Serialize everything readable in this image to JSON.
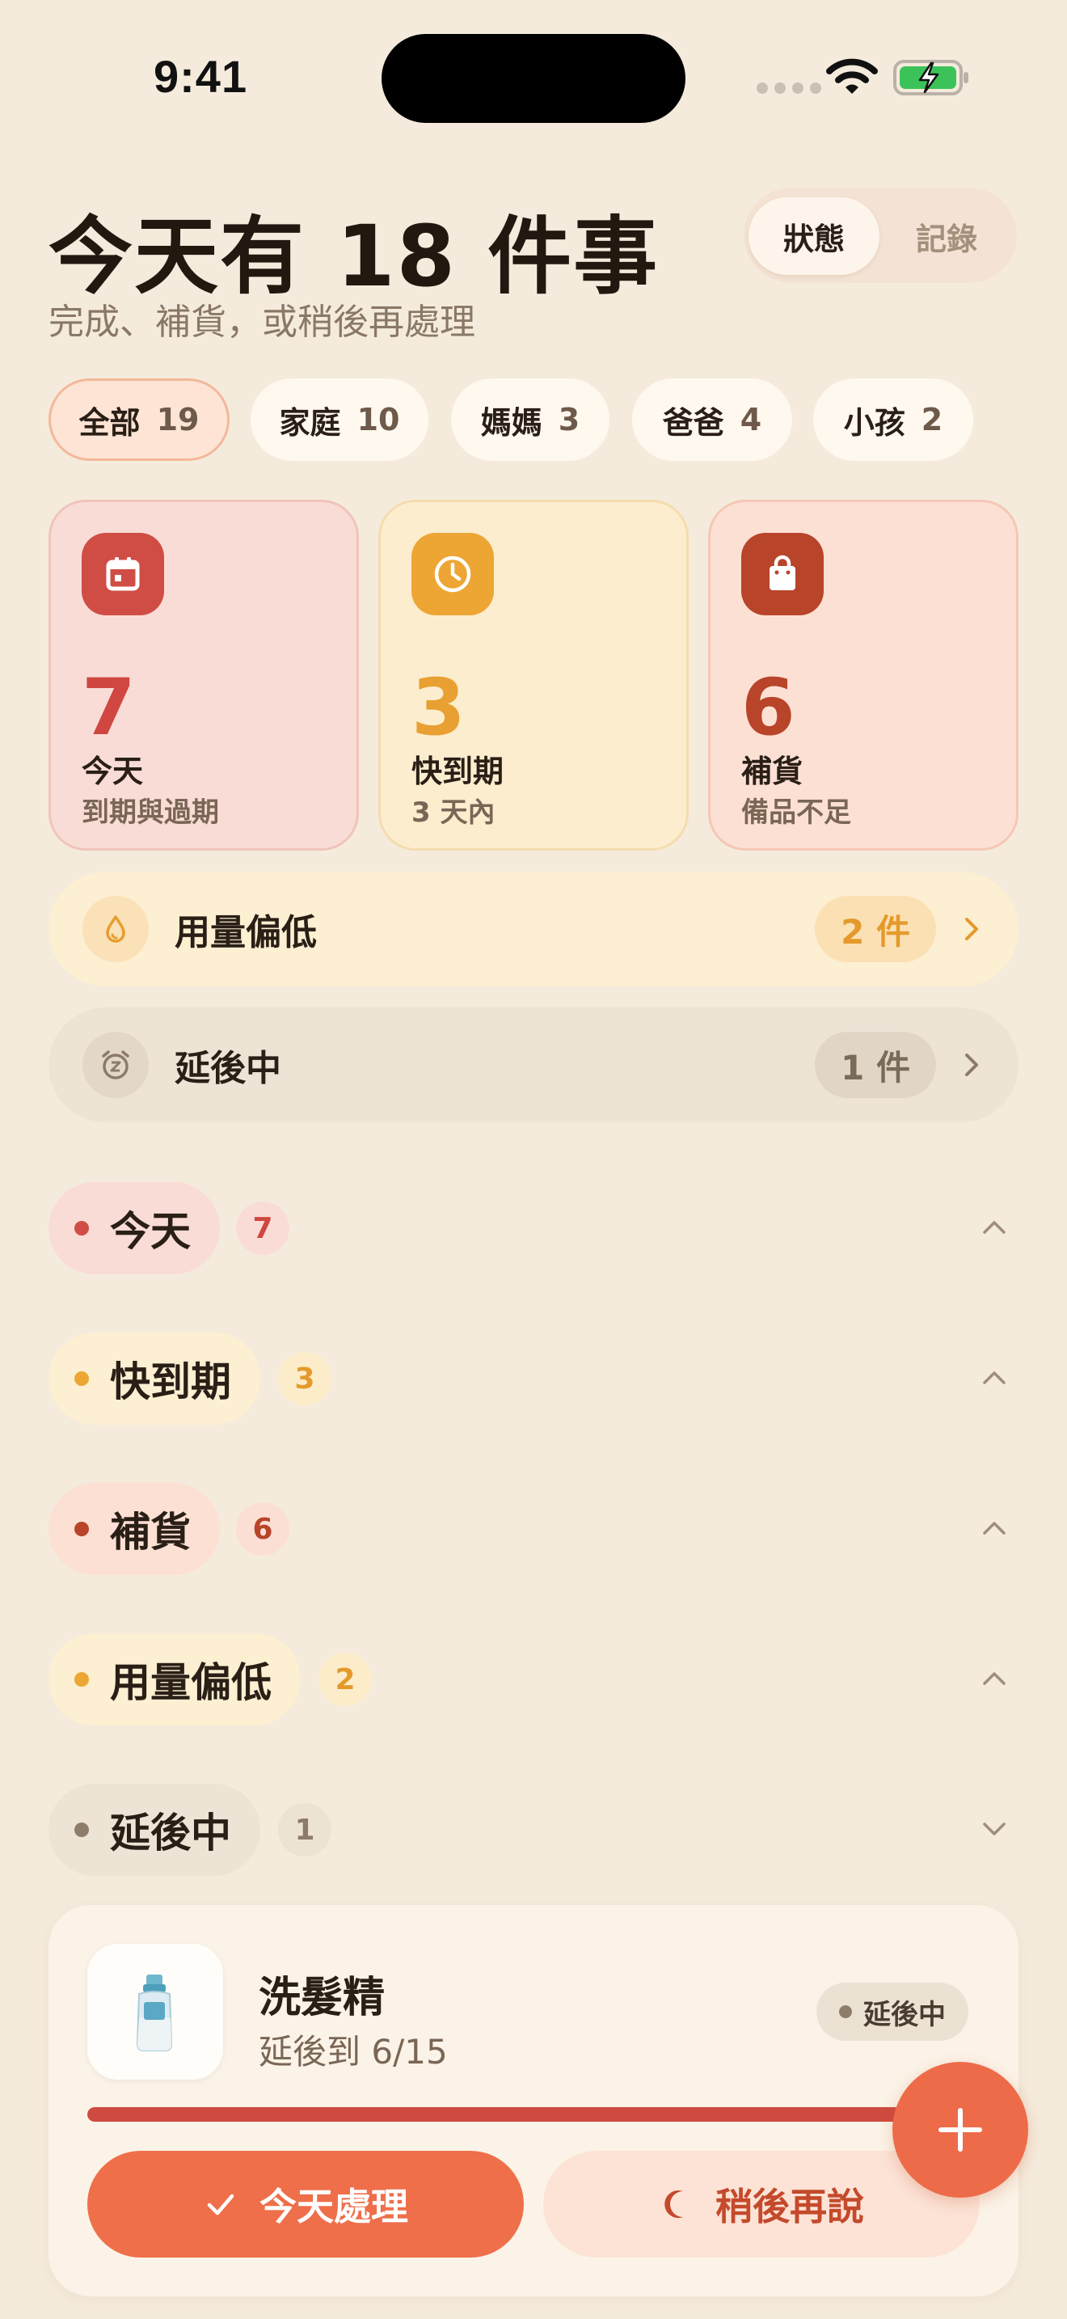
{
  "status_bar": {
    "time": "9:41"
  },
  "header": {
    "title": "今天有 18 件事",
    "subtitle": "完成、補貨，或稍後再處理",
    "segment": {
      "active": "狀態",
      "inactive": "記錄"
    }
  },
  "filters": [
    {
      "label": "全部",
      "count": "19",
      "active": true
    },
    {
      "label": "家庭",
      "count": "10"
    },
    {
      "label": "媽媽",
      "count": "3"
    },
    {
      "label": "爸爸",
      "count": "4"
    },
    {
      "label": "小孩",
      "count": "2"
    }
  ],
  "stats": [
    {
      "value": "7",
      "label": "今天",
      "sub": "到期與過期",
      "icon": "calendar-icon"
    },
    {
      "value": "3",
      "label": "快到期",
      "sub": "3 天內",
      "icon": "clock-icon"
    },
    {
      "value": "6",
      "label": "補貨",
      "sub": "備品不足",
      "icon": "shopping-bag-icon"
    }
  ],
  "rows": [
    {
      "label": "用量偏低",
      "count": "2 件",
      "icon": "droplet-icon"
    },
    {
      "label": "延後中",
      "count": "1 件",
      "icon": "snooze-alarm-icon"
    }
  ],
  "sections": [
    {
      "label": "今天",
      "count": "7",
      "expanded": true
    },
    {
      "label": "快到期",
      "count": "3",
      "expanded": true
    },
    {
      "label": "補貨",
      "count": "6",
      "expanded": true
    },
    {
      "label": "用量偏低",
      "count": "2",
      "expanded": true
    },
    {
      "label": "延後中",
      "count": "1",
      "expanded": false
    }
  ],
  "item": {
    "name": "洗髮精",
    "sub": "延後到 6/15",
    "badge": "延後中",
    "progress": 1.0,
    "icon": "shampoo-bottle-icon",
    "primary_action": "今天處理",
    "secondary_action": "稍後再說"
  },
  "colors": {
    "background": "#f5ebdc",
    "today": "#d04d45",
    "soon": "#eda634",
    "restock": "#b8442a",
    "accent": "#ee6f4a"
  }
}
